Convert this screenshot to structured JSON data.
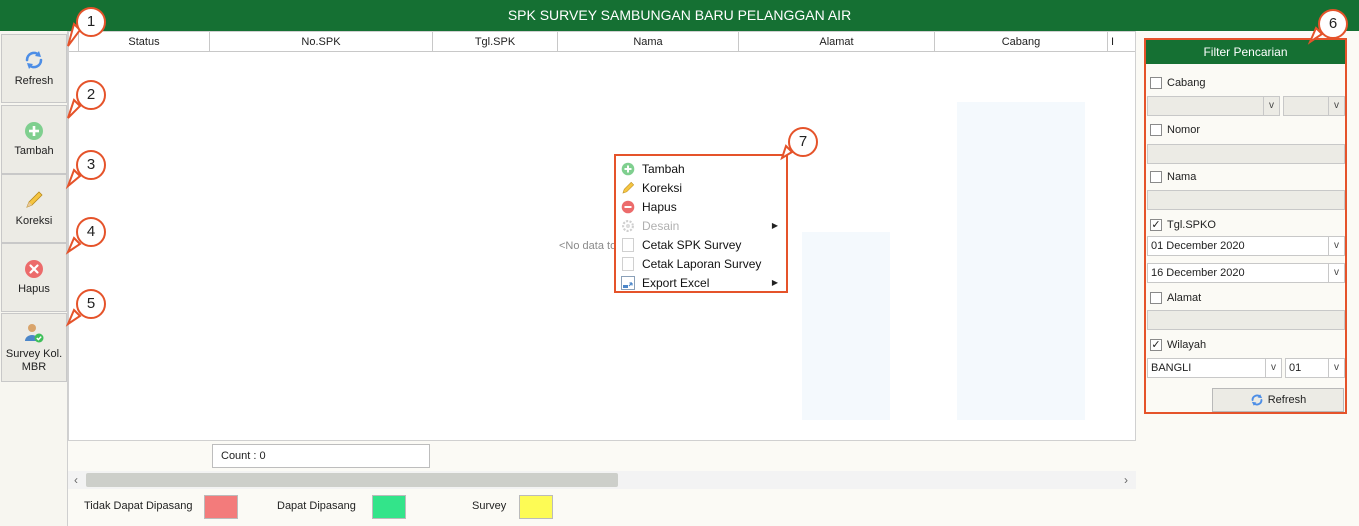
{
  "window": {
    "title": "SPK SURVEY SAMBUNGAN BARU PELANGGAN AIR"
  },
  "toolbar": {
    "refresh": "Refresh",
    "tambah": "Tambah",
    "koreksi": "Koreksi",
    "hapus": "Hapus",
    "survey_kol": "Survey Kol. MBR"
  },
  "grid": {
    "columns": [
      "Status",
      "No.SPK",
      "Tgl.SPK",
      "Nama",
      "Alamat",
      "Cabang",
      "I"
    ],
    "empty_text": "<No data to display>",
    "count": "Count : 0"
  },
  "legend": [
    {
      "label": "Tidak Dapat Dipasang",
      "color": "#f37b7b"
    },
    {
      "label": "Dapat Dipasang",
      "color": "#33e48a"
    },
    {
      "label": "Survey",
      "color": "#fdfb55"
    }
  ],
  "filter": {
    "title": "Filter Pencarian",
    "cabang": {
      "label": "Cabang",
      "checked": false
    },
    "nomor": {
      "label": "Nomor",
      "checked": false
    },
    "nama": {
      "label": "Nama",
      "checked": false
    },
    "tgl_spko": {
      "label": "Tgl.SPKO",
      "checked": true,
      "from": "01 December 2020",
      "to": "16 December 2020"
    },
    "alamat": {
      "label": "Alamat",
      "checked": false
    },
    "wilayah": {
      "label": "Wilayah",
      "checked": true,
      "value": "BANGLI",
      "sub": "01"
    },
    "refresh": "Refresh"
  },
  "context_menu": [
    {
      "label": "Tambah",
      "icon": "plus-circle-icon",
      "disabled": false,
      "submenu": false
    },
    {
      "label": "Koreksi",
      "icon": "pencil-icon",
      "disabled": false,
      "submenu": false
    },
    {
      "label": "Hapus",
      "icon": "minus-circle-icon",
      "disabled": false,
      "submenu": false
    },
    {
      "label": "Desain",
      "icon": "gear-icon",
      "disabled": true,
      "submenu": true
    },
    {
      "label": "Cetak SPK Survey",
      "icon": "document-icon",
      "disabled": false,
      "submenu": false
    },
    {
      "label": "Cetak Laporan Survey",
      "icon": "document-icon",
      "disabled": false,
      "submenu": false
    },
    {
      "label": "Export Excel",
      "icon": "export-icon",
      "disabled": false,
      "submenu": true
    }
  ],
  "callouts": [
    "1",
    "2",
    "3",
    "4",
    "5",
    "6",
    "7"
  ],
  "colors": {
    "accent_green": "#157033",
    "highlight_red": "#e5532a"
  }
}
